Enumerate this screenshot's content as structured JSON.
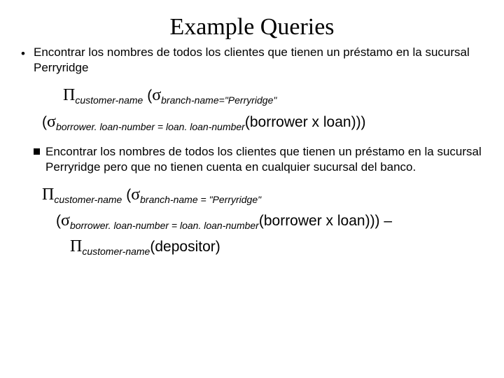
{
  "title": "Example Queries",
  "bullet1": "Encontrar los nombres de todos los clientes que tienen un préstamo en la sucursal Perryridge",
  "formula1": {
    "pi_sub": "customer-name",
    "sigma1_sub": "branch-name",
    "eq1_rhs": "=\"Perryridge\"",
    "sigma2_sub": "borrower. loan-number = loan. loan-number",
    "join_expr": "(borrower x loan)))"
  },
  "bullet2": "Encontrar los nombres de todos los clientes que tienen un préstamo en la sucursal Perryridge pero que no tienen cuenta en cualquier sucursal del banco.",
  "formula2": {
    "pi1_sub": "customer-name",
    "sigma1_sub": "branch-name = \"Perryridge\"",
    "sigma2_sub": "borrower. loan-number = loan. loan-number",
    "join_expr": "(borrower x loan)))",
    "minus": " – ",
    "pi2_sub": "customer-name",
    "dep_expr": "(depositor)"
  }
}
